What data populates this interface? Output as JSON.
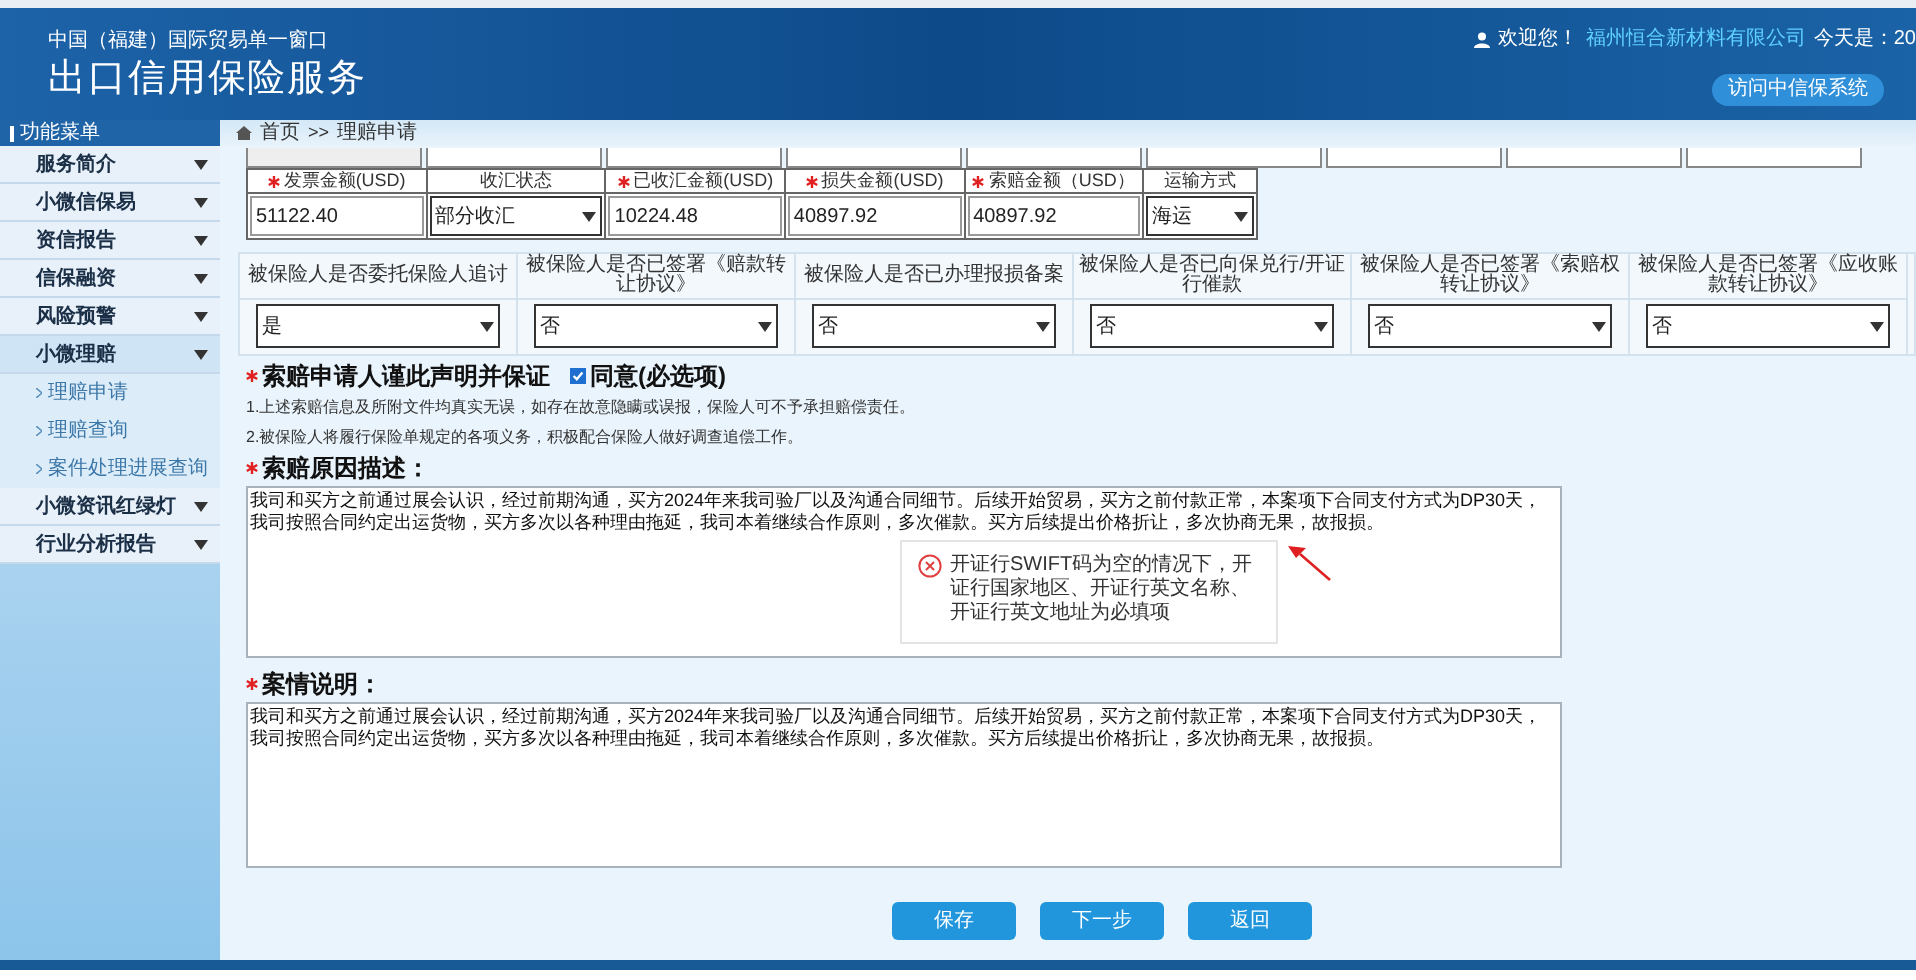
{
  "header": {
    "subtitle": "中国（福建）国际贸易单一窗口",
    "title": "出口信用保险服务",
    "welcome": "欢迎您！",
    "company": "福州恒合新材料有限公司",
    "date_label": "今天是：20",
    "link_button": "访问中信保系统"
  },
  "sidebar": {
    "heading": "功能菜单",
    "items": [
      {
        "label": "服务简介",
        "expanded": false
      },
      {
        "label": "小微信保易",
        "expanded": false
      },
      {
        "label": "资信报告",
        "expanded": false
      },
      {
        "label": "信保融资",
        "expanded": false
      },
      {
        "label": "风险预警",
        "expanded": false
      },
      {
        "label": "小微理赔",
        "expanded": true,
        "children": [
          {
            "label": "理赔申请"
          },
          {
            "label": "理赔查询"
          },
          {
            "label": "案件处理进展查询"
          }
        ]
      },
      {
        "label": "小微资讯红绿灯",
        "expanded": false
      },
      {
        "label": "行业分析报告",
        "expanded": false
      }
    ]
  },
  "breadcrumb": {
    "home": "首页",
    "separator": ">>",
    "current": "理赔申请"
  },
  "amount_table": {
    "columns": [
      {
        "label": "发票金额(USD)",
        "required": true,
        "kind": "input",
        "value": "51122.40"
      },
      {
        "label": "收汇状态",
        "required": false,
        "kind": "select",
        "value": "部分收汇"
      },
      {
        "label": "已收汇金额(USD)",
        "required": true,
        "kind": "input",
        "value": "10224.48"
      },
      {
        "label": "损失金额(USD)",
        "required": true,
        "kind": "input",
        "value": "40897.92"
      },
      {
        "label": "索赔金额（USD）",
        "required": true,
        "kind": "input",
        "value": "40897.92"
      },
      {
        "label": "运输方式",
        "required": false,
        "kind": "select",
        "value": "海运"
      }
    ]
  },
  "questions": [
    {
      "label": "被保险人是否委托保险人追讨",
      "answer": "是"
    },
    {
      "label": "被保险人是否已签署《赔款转让协议》",
      "answer": "否"
    },
    {
      "label": "被保险人是否已办理报损备案",
      "answer": "否"
    },
    {
      "label": "被保险人是否已向保兑行/开证行催款",
      "answer": "否"
    },
    {
      "label": "被保险人是否已签署《索赔权转让协议》",
      "answer": "否"
    },
    {
      "label": "被保险人是否已签署《应收账款转让协议》",
      "answer": "否"
    }
  ],
  "declaration": {
    "label": "索赔申请人谨此声明并保证",
    "required": true,
    "agree": {
      "label": "同意(必选项)",
      "checked": true
    },
    "notes": [
      "1.上述索赔信息及所附文件均真实无误，如存在故意隐瞒或误报，保险人可不予承担赔偿责任。",
      "2.被保险人将履行保险单规定的各项义务，积极配合保险人做好调查追偿工作。"
    ]
  },
  "reason": {
    "label": "索赔原因描述：",
    "required": true,
    "text": "我司和买方之前通过展会认识，经过前期沟通，买方2024年来我司验厂以及沟通合同细节。后续开始贸易，买方之前付款正常，本案项下合同支付方式为DP30天，我司按照合同约定出运货物，买方多次以各种理由拖延，我司本着继续合作原则，多次催款。买方后续提出价格折让，多次协商无果，故报损。"
  },
  "case": {
    "label": "案情说明：",
    "required": true,
    "text": "我司和买方之前通过展会认识，经过前期沟通，买方2024年来我司验厂以及沟通合同细节。后续开始贸易，买方之前付款正常，本案项下合同支付方式为DP30天，我司按照合同约定出运货物，买方多次以各种理由拖延，我司本着继续合作原则，多次催款。买方后续提出价格折让，多次协商无果，故报损。"
  },
  "error_tooltip": {
    "message": "开证行SWIFT码为空的情况下，开证行国家地区、开证行英文名称、开证行英文地址为必填项"
  },
  "buttons": [
    "保存",
    "下一步",
    "返回"
  ]
}
